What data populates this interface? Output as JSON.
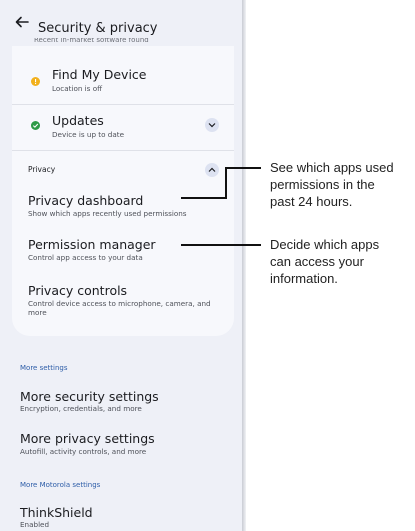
{
  "header": {
    "title": "Security & privacy",
    "truncated_text": "Recent in-market software found"
  },
  "security_items": [
    {
      "title": "Find My Device",
      "subtitle": "Location is off",
      "status_color": "#f2b01c",
      "icon": "info-dot-icon"
    },
    {
      "title": "Updates",
      "subtitle": "Device is up to date",
      "status_color": "#2e9a47",
      "icon": "check-dot-icon"
    }
  ],
  "privacy": {
    "label": "Privacy",
    "items": [
      {
        "title": "Privacy dashboard",
        "subtitle": "Show which apps recently used permissions"
      },
      {
        "title": "Permission manager",
        "subtitle": "Control app access to your data"
      },
      {
        "title": "Privacy controls",
        "subtitle": "Control device access to microphone, camera, and more"
      }
    ]
  },
  "more_settings": {
    "label": "More settings",
    "items": [
      {
        "title": "More security settings",
        "subtitle": "Encryption, credentials, and more"
      },
      {
        "title": "More privacy settings",
        "subtitle": "Autofill, activity controls, and more"
      }
    ]
  },
  "motorola": {
    "label": "More Motorola settings",
    "items": [
      {
        "title": "ThinkShield",
        "subtitle": "Enabled"
      }
    ]
  },
  "callouts": [
    {
      "lines": [
        "See which apps used",
        "permissions in the",
        "past 24 hours."
      ]
    },
    {
      "lines": [
        "Decide which apps",
        "can access your",
        "information."
      ]
    }
  ],
  "colors": {
    "accent_blue": "#2d5da8",
    "background": "#eef0f7",
    "card": "#f7f8fc"
  }
}
